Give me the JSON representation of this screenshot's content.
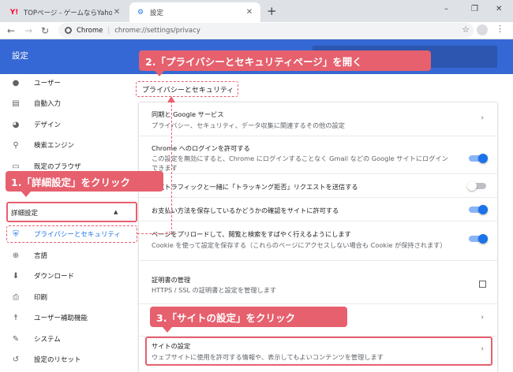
{
  "browser": {
    "tabs": [
      {
        "title": "TOPページ - ゲームならYahoo!モバゲー",
        "favicon": "yahoo-y-icon",
        "active": false
      },
      {
        "title": "設定",
        "favicon": "settings-gear-icon",
        "active": true
      }
    ],
    "new_tab": "+",
    "window_controls": [
      "–",
      "❐",
      "✕"
    ],
    "omnibox": {
      "label": "Chrome",
      "url": "chrome://settings/privacy"
    }
  },
  "settings": {
    "header_title": "設定",
    "sidebar": {
      "items": [
        {
          "label": "ユーザー",
          "icon": "person-icon",
          "glyph": "●"
        },
        {
          "label": "自動入力",
          "icon": "clipboard-icon",
          "glyph": "▤"
        },
        {
          "label": "デザイン",
          "icon": "palette-icon",
          "glyph": "◕"
        },
        {
          "label": "検索エンジン",
          "icon": "search-icon",
          "glyph": "⚲"
        },
        {
          "label": "既定のブラウザ",
          "icon": "browser-icon",
          "glyph": "▭"
        }
      ],
      "advanced_label": "詳細設定",
      "advanced_caret": "▲",
      "advanced_items": [
        {
          "label": "プライバシーとセキュリティ",
          "icon": "shield-icon",
          "glyph": "⛨",
          "selected": true
        },
        {
          "label": "言語",
          "icon": "globe-icon",
          "glyph": "⊕"
        },
        {
          "label": "ダウンロード",
          "icon": "download-icon",
          "glyph": "⬇"
        },
        {
          "label": "印刷",
          "icon": "printer-icon",
          "glyph": "⎙"
        },
        {
          "label": "ユーザー補助機能",
          "icon": "accessibility-icon",
          "glyph": "☨"
        },
        {
          "label": "システム",
          "icon": "wrench-icon",
          "glyph": "✎"
        },
        {
          "label": "設定のリセット",
          "icon": "reset-icon",
          "glyph": "↺"
        }
      ]
    },
    "section_title": "プライバシーとセキュリティ",
    "rows": [
      {
        "title": "同期と Google サービス",
        "subtitle": "プライバシー、セキュリティ、データ収集に関連するその他の設定",
        "control": "chevron"
      },
      {
        "title": "Chrome へのログインを許可する",
        "subtitle": "この設定を無効にすると、Chrome にログインすることなく Gmail などの Google サイトにログイン",
        "subtitle2": "できます",
        "control": "toggle",
        "on": true
      },
      {
        "title": "閲覧トラフィックと一緒に「トラッキング拒否」リクエストを送信する",
        "control": "toggle",
        "on": false
      },
      {
        "title": "お支払い方法を保存しているかどうかの確認をサイトに許可する",
        "control": "toggle",
        "on": true
      },
      {
        "title": "ページをプリロードして、閲覧と検索をすばやく行えるようにします",
        "subtitle": "Cookie を使って設定を保存する（これらのページにアクセスしない場合も Cookie が保持されます）",
        "control": "toggle",
        "on": true
      },
      {
        "title": "証明書の管理",
        "subtitle": "HTTPS / SSL の証明書と設定を管理します",
        "control": "external"
      },
      {
        "title": "",
        "control": "chevron"
      },
      {
        "title": "サイトの設定",
        "subtitle": "ウェブサイトに使用を許可する情報や、表示してもよいコンテンツを管理します",
        "control": "chevron"
      }
    ]
  },
  "annotations": {
    "step1": "1.「詳細設定」をクリック",
    "step2": "2.「プライバシーとセキュリティページ」を開く",
    "step3": "3.「サイトの設定」をクリック"
  },
  "colors": {
    "header_blue": "#3568d4",
    "accent_blue": "#1a73e8",
    "annotation_pink": "#e6606e"
  }
}
